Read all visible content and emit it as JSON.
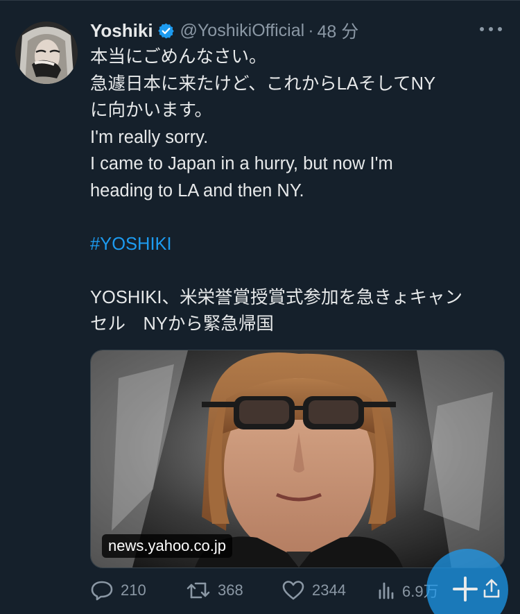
{
  "tweet": {
    "display_name": "Yoshiki",
    "handle": "@YoshikiOfficial",
    "separator": "·",
    "time": "48 分",
    "body_lines": [
      "本当にごめんなさい。",
      "急遽日本に来たけど、これからLAそしてNY",
      "に向かいます。",
      "I'm really sorry.",
      "I came to Japan in a hurry, but now I'm",
      "heading to LA and then NY."
    ],
    "hashtag": "#YOSHIKI",
    "headline_lines": [
      "YOSHIKI、米栄誉賞授賞式参加を急きょキャン",
      "セル　NYから緊急帰国"
    ],
    "card_domain": "news.yahoo.co.jp",
    "stats": {
      "replies": "210",
      "retweets": "368",
      "likes": "2344",
      "views": "6.9万"
    }
  },
  "colors": {
    "background": "#15202b",
    "text": "#e7e9ea",
    "secondary": "#8b98a5",
    "accent": "#1d9bf0"
  },
  "icons": [
    "verified-badge-icon",
    "more-icon",
    "reply-icon",
    "retweet-icon",
    "like-icon",
    "views-icon",
    "share-icon",
    "compose-plus-icon"
  ]
}
